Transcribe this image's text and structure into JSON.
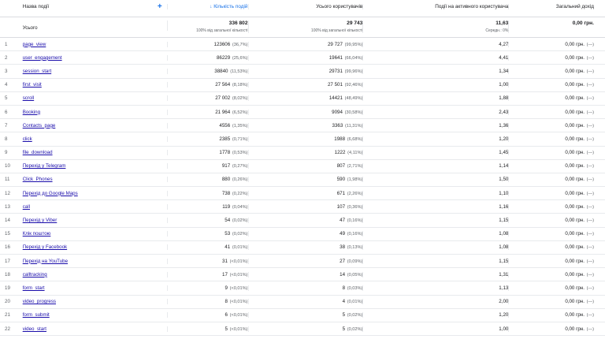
{
  "header": {
    "name_col": "Назва події",
    "events_col": "Кількість подій",
    "users_col": "Усього користувачів",
    "per_user_col": "Події на активного користувача",
    "revenue_col": "Загальний дохід"
  },
  "total": {
    "label": "Усього",
    "events": "336 802",
    "events_sub": "100% від загальної кількості",
    "users": "29 743",
    "users_sub": "100% від загальної кількості",
    "per_user": "11,63",
    "per_user_sub": "Середн.: 0%",
    "revenue": "0,00 грн."
  },
  "rows": [
    {
      "idx": "1",
      "name": "page_view",
      "events": "123606",
      "events_pct": "(36,7%)",
      "users": "29 727",
      "users_pct": "(99,95%)",
      "per_user": "4,27",
      "revenue": "0,00 грн.",
      "rev_pct": "(—)"
    },
    {
      "idx": "2",
      "name": "user_engagement",
      "events": "86229",
      "events_pct": "(25,6%)",
      "users": "19641",
      "users_pct": "(66,04%)",
      "per_user": "4,41",
      "revenue": "0,00 грн.",
      "rev_pct": "(—)"
    },
    {
      "idx": "3",
      "name": "session_start",
      "events": "38840",
      "events_pct": "(11,53%)",
      "users": "29731",
      "users_pct": "(99,96%)",
      "per_user": "1,34",
      "revenue": "0,00 грн.",
      "rev_pct": "(—)"
    },
    {
      "idx": "4",
      "name": "first_visit",
      "events": "27 564",
      "events_pct": "(8,18%)",
      "users": "27 501",
      "users_pct": "(92,46%)",
      "per_user": "1,00",
      "revenue": "0,00 грн.",
      "rev_pct": "(—)"
    },
    {
      "idx": "5",
      "name": "scroll",
      "events": "27 002",
      "events_pct": "(8,02%)",
      "users": "14421",
      "users_pct": "(48,49%)",
      "per_user": "1,88",
      "revenue": "0,00 грн.",
      "rev_pct": "(—)"
    },
    {
      "idx": "6",
      "name": "Booking",
      "events": "21 964",
      "events_pct": "(6,52%)",
      "users": "9094",
      "users_pct": "(30,58%)",
      "per_user": "2,43",
      "revenue": "0,00 грн.",
      "rev_pct": "(—)"
    },
    {
      "idx": "7",
      "name": "Contacts_page",
      "events": "4556",
      "events_pct": "(1,35%)",
      "users": "3363",
      "users_pct": "(11,31%)",
      "per_user": "1,36",
      "revenue": "0,00 грн.",
      "rev_pct": "(—)"
    },
    {
      "idx": "8",
      "name": "click",
      "events": "2385",
      "events_pct": "(0,71%)",
      "users": "1988",
      "users_pct": "(6,68%)",
      "per_user": "1,20",
      "revenue": "0,00 грн.",
      "rev_pct": "(—)"
    },
    {
      "idx": "9",
      "name": "file_download",
      "events": "1778",
      "events_pct": "(0,53%)",
      "users": "1222",
      "users_pct": "(4,11%)",
      "per_user": "1,45",
      "revenue": "0,00 грн.",
      "rev_pct": "(—)"
    },
    {
      "idx": "10",
      "name": "Перехід у Telegram",
      "events": "917",
      "events_pct": "(0,27%)",
      "users": "807",
      "users_pct": "(2,71%)",
      "per_user": "1,14",
      "revenue": "0,00 грн.",
      "rev_pct": "(—)"
    },
    {
      "idx": "11",
      "name": "Click_Phones",
      "events": "880",
      "events_pct": "(0,26%)",
      "users": "590",
      "users_pct": "(1,98%)",
      "per_user": "1,50",
      "revenue": "0,00 грн.",
      "rev_pct": "(—)"
    },
    {
      "idx": "12",
      "name": "Перехід до Google Maps",
      "events": "738",
      "events_pct": "(0,22%)",
      "users": "671",
      "users_pct": "(2,26%)",
      "per_user": "1,10",
      "revenue": "0,00 грн.",
      "rev_pct": "(—)"
    },
    {
      "idx": "13",
      "name": "call",
      "events": "119",
      "events_pct": "(0,04%)",
      "users": "107",
      "users_pct": "(0,36%)",
      "per_user": "1,16",
      "revenue": "0,00 грн.",
      "rev_pct": "(—)"
    },
    {
      "idx": "14",
      "name": "Перехід у Viber",
      "events": "54",
      "events_pct": "(0,02%)",
      "users": "47",
      "users_pct": "(0,16%)",
      "per_user": "1,15",
      "revenue": "0,00 грн.",
      "rev_pct": "(—)"
    },
    {
      "idx": "15",
      "name": "Клік поштою",
      "events": "53",
      "events_pct": "(0,02%)",
      "users": "49",
      "users_pct": "(0,16%)",
      "per_user": "1,08",
      "revenue": "0,00 грн.",
      "rev_pct": "(—)"
    },
    {
      "idx": "16",
      "name": "Перехід у Facebook",
      "events": "41",
      "events_pct": "(0,01%)",
      "users": "38",
      "users_pct": "(0,13%)",
      "per_user": "1,08",
      "revenue": "0,00 грн.",
      "rev_pct": "(—)"
    },
    {
      "idx": "17",
      "name": "Перехід на YouTube",
      "events": "31",
      "events_pct": "(<0,01%)",
      "users": "27",
      "users_pct": "(0,09%)",
      "per_user": "1,15",
      "revenue": "0,00 грн.",
      "rev_pct": "(—)"
    },
    {
      "idx": "18",
      "name": "calltracking",
      "events": "17",
      "events_pct": "(<0,01%)",
      "users": "14",
      "users_pct": "(0,05%)",
      "per_user": "1,31",
      "revenue": "0,00 грн.",
      "rev_pct": "(—)"
    },
    {
      "idx": "19",
      "name": "form_start",
      "events": "9",
      "events_pct": "(<0,01%)",
      "users": "8",
      "users_pct": "(0,03%)",
      "per_user": "1,13",
      "revenue": "0,00 грн.",
      "rev_pct": "(—)"
    },
    {
      "idx": "20",
      "name": "video_progress",
      "events": "8",
      "events_pct": "(<0,01%)",
      "users": "4",
      "users_pct": "(0,01%)",
      "per_user": "2,00",
      "revenue": "0,00 грн.",
      "rev_pct": "(—)"
    },
    {
      "idx": "21",
      "name": "form_submit",
      "events": "6",
      "events_pct": "(<0,01%)",
      "users": "5",
      "users_pct": "(0,02%)",
      "per_user": "1,20",
      "revenue": "0,00 грн.",
      "rev_pct": "(—)"
    },
    {
      "idx": "22",
      "name": "video_start",
      "events": "5",
      "events_pct": "(<0,01%)",
      "users": "5",
      "users_pct": "(0,02%)",
      "per_user": "1,00",
      "revenue": "0,00 грн.",
      "rev_pct": "(—)"
    }
  ]
}
